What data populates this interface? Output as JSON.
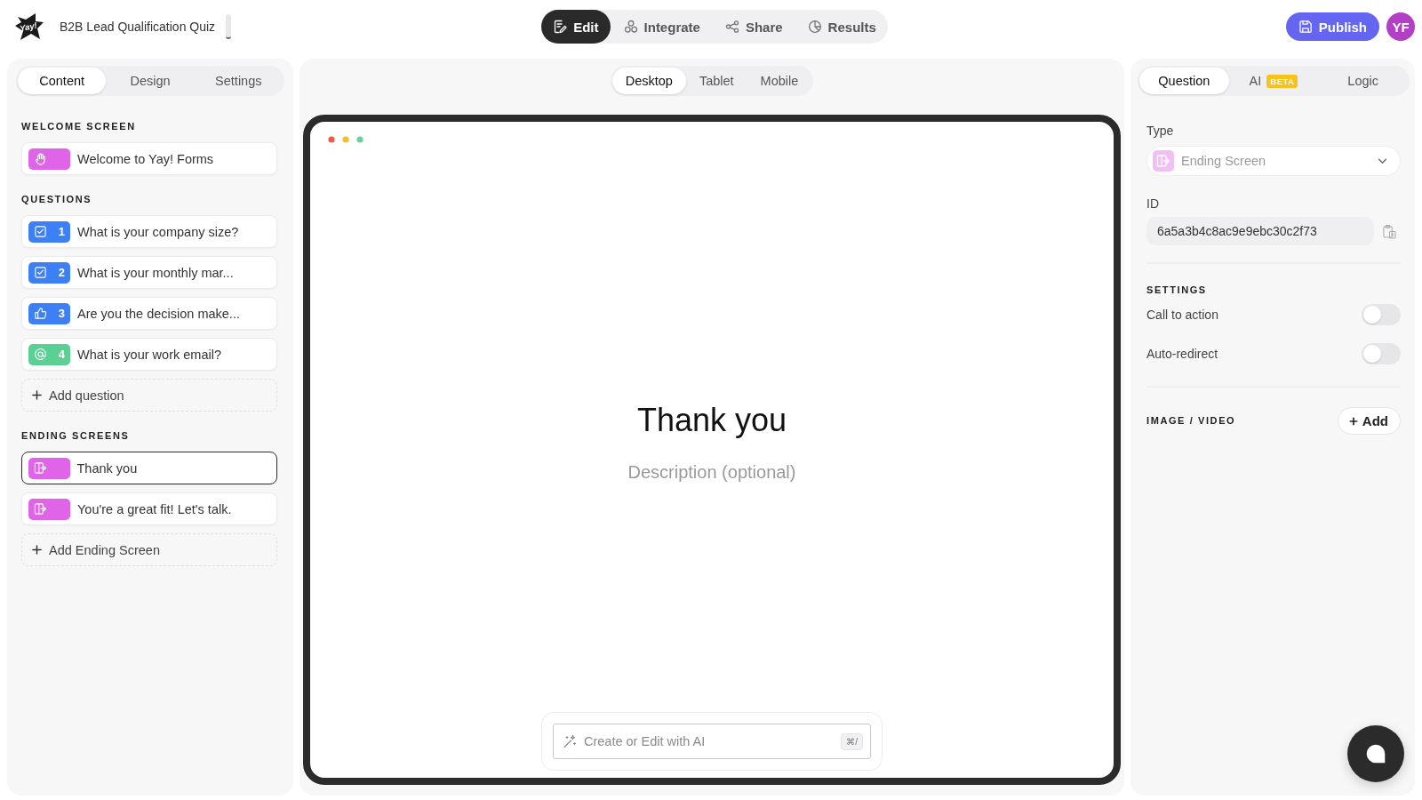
{
  "header": {
    "logo_text": "Yay!",
    "title": "B2B Lead Qualification Quiz",
    "nav": [
      {
        "kind": "edit",
        "label": "Edit",
        "selected": true
      },
      {
        "kind": "integrate",
        "label": "Integrate",
        "selected": false
      },
      {
        "kind": "share",
        "label": "Share",
        "selected": false
      },
      {
        "kind": "results",
        "label": "Results",
        "selected": false
      }
    ],
    "publish_label": "Publish",
    "avatar_initials": "YF"
  },
  "left_panel": {
    "tabs": [
      {
        "label": "Content",
        "selected": true
      },
      {
        "label": "Design",
        "selected": false
      },
      {
        "label": "Settings",
        "selected": false
      }
    ],
    "sections": [
      {
        "heading": "WELCOME SCREEN",
        "items": [
          {
            "kind": "welcome",
            "color": "#e064e8",
            "label": "Welcome to Yay! Forms",
            "selected": false
          }
        ]
      },
      {
        "heading": "QUESTIONS",
        "items": [
          {
            "kind": "checkbox",
            "color": "#3d80f5",
            "number": "1",
            "label": "What is your company size?",
            "selected": false
          },
          {
            "kind": "checkbox",
            "color": "#3d80f5",
            "number": "2",
            "label": "What is your monthly mar...",
            "selected": false
          },
          {
            "kind": "thumbs",
            "color": "#3d80f5",
            "number": "3",
            "label": "Are you the decision make...",
            "selected": false
          },
          {
            "kind": "email",
            "color": "#5ccf94",
            "number": "4",
            "label": "What is your work email?",
            "selected": false
          }
        ],
        "add_label": "Add question"
      },
      {
        "heading": "ENDING SCREENS",
        "items": [
          {
            "kind": "ending",
            "color": "#e064e8",
            "label": "Thank you",
            "selected": true
          },
          {
            "kind": "ending",
            "color": "#e064e8",
            "label": "You're a great fit! Let's talk.",
            "selected": false
          }
        ],
        "add_label": "Add Ending Screen"
      }
    ]
  },
  "preview": {
    "device_tabs": [
      {
        "label": "Desktop",
        "selected": true
      },
      {
        "label": "Tablet",
        "selected": false
      },
      {
        "label": "Mobile",
        "selected": false
      }
    ],
    "title": "Thank you",
    "description": {
      "placeholder": "Description (optional)"
    },
    "ai_prompt": {
      "placeholder": "Create or Edit with AI",
      "shortcut": "⌘/"
    }
  },
  "right_panel": {
    "tabs": [
      {
        "label": "Question",
        "selected": true
      },
      {
        "label": "AI",
        "badge": "BETA",
        "selected": false
      },
      {
        "label": "Logic",
        "selected": false
      }
    ],
    "type_field": {
      "label": "Type",
      "kind": "ending",
      "value": "Ending Screen",
      "disabled": true
    },
    "id_field": {
      "label": "ID",
      "value": "6a5a3b4c8ac9e9ebc30c2f73"
    },
    "settings": {
      "heading": "SETTINGS",
      "toggles": [
        {
          "label": "Call to action",
          "on": false
        },
        {
          "label": "Auto-redirect",
          "on": false
        }
      ]
    },
    "media": {
      "heading": "IMAGE / VIDEO",
      "button_label": "Add"
    }
  }
}
